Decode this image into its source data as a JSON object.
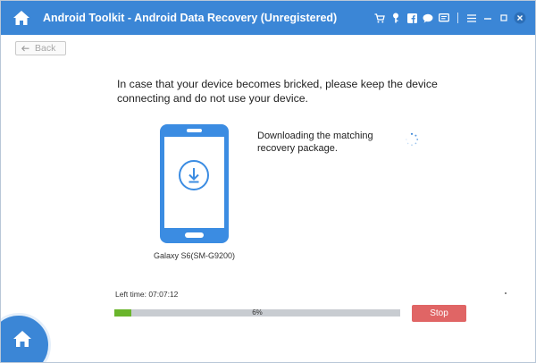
{
  "window": {
    "title": "Android Toolkit - Android Data Recovery (Unregistered)",
    "accent_color": "#3b86d6"
  },
  "titlebar_icons": [
    "home-icon",
    "cart-icon",
    "key-icon",
    "facebook-icon",
    "chat-icon",
    "feedback-icon",
    "menu-icon",
    "minimize-icon",
    "maximize-icon",
    "close-icon"
  ],
  "toolbar": {
    "back_label": "Back"
  },
  "main": {
    "warning": "In case that your device becomes bricked, please keep the device connecting and do not use your device.",
    "status": "Downloading the matching recovery package.",
    "device_name": "Galaxy S6(SM-G9200)",
    "left_time_label": "Left time: 07:07:12",
    "progress_value": 0.06,
    "progress_label": "6%",
    "progress_color": "#6ab52c",
    "stop_label": "Stop",
    "stop_color": "#e06565"
  }
}
